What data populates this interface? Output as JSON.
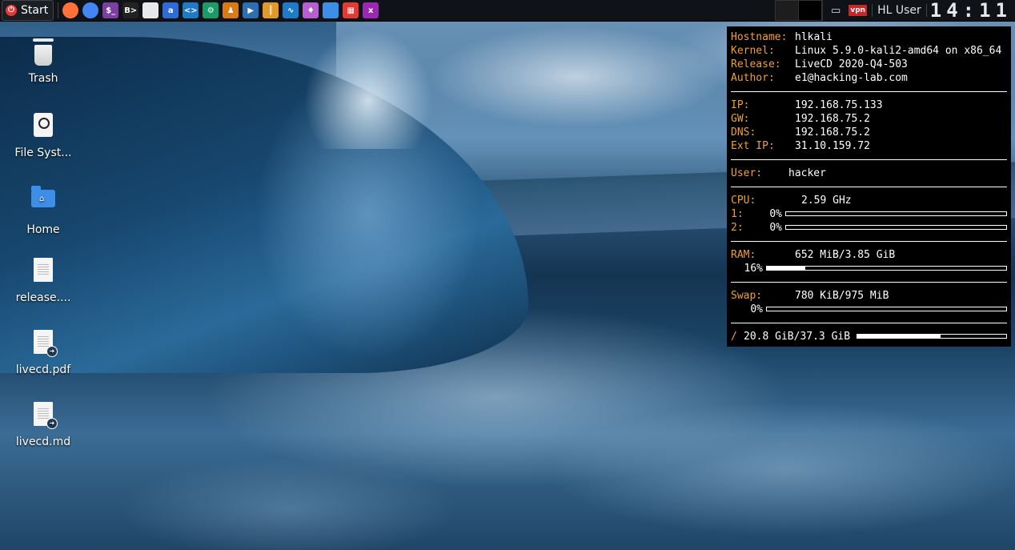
{
  "taskbar": {
    "start_label": "Start",
    "launchers": [
      {
        "name": "firefox-icon",
        "color": "#ff7139",
        "glyph": ""
      },
      {
        "name": "chrome-icon",
        "color": "#4285f4",
        "glyph": ""
      },
      {
        "name": "terminal-purple-icon",
        "color": "#7b3fa0",
        "glyph": "$_"
      },
      {
        "name": "root-terminal-icon",
        "color": "#222",
        "glyph": "B>"
      },
      {
        "name": "files-icon",
        "color": "#e8e8e8",
        "glyph": ""
      },
      {
        "name": "app-a-icon",
        "color": "#2d6bd6",
        "glyph": "a"
      },
      {
        "name": "vscode-icon",
        "color": "#1e79c8",
        "glyph": "<>"
      },
      {
        "name": "gear-app-icon",
        "color": "#1a9b6a",
        "glyph": "⚙"
      },
      {
        "name": "burp-icon",
        "color": "#d97a16",
        "glyph": "♟"
      },
      {
        "name": "shark-icon",
        "color": "#2e6fb4",
        "glyph": "▶"
      },
      {
        "name": "bookmark-icon",
        "color": "#e09a2c",
        "glyph": "║"
      },
      {
        "name": "wireshark-icon",
        "color": "#1d7bc9",
        "glyph": "∿"
      },
      {
        "name": "fire-icon",
        "color": "#b65fd0",
        "glyph": "♦"
      },
      {
        "name": "folder-icon",
        "color": "#3d8ee6",
        "glyph": ""
      },
      {
        "name": "grid-app-icon",
        "color": "#e53935",
        "glyph": "▦"
      },
      {
        "name": "monitor-icon",
        "color": "#9c27b0",
        "glyph": "x"
      }
    ],
    "tray_user": "HL User",
    "vpn_label": "vpn",
    "clock": "14:11"
  },
  "desktop_icons": [
    {
      "label": "Trash"
    },
    {
      "label": "File Syst..."
    },
    {
      "label": "Home"
    },
    {
      "label": "release...."
    },
    {
      "label": "livecd.pdf"
    },
    {
      "label": "livecd.md"
    }
  ],
  "conky": {
    "hostname_key": "Hostname:",
    "hostname": "hlkali",
    "kernel_key": "Kernel:",
    "kernel": "Linux 5.9.0-kali2-amd64 on x86_64",
    "release_key": "Release:",
    "release": "LiveCD 2020-Q4-503",
    "author_key": "Author:",
    "author": "e1@hacking-lab.com",
    "ip_key": "IP:",
    "ip": "192.168.75.133",
    "gw_key": "GW:",
    "gw": "192.168.75.2",
    "dns_key": "DNS:",
    "dns": "192.168.75.2",
    "extip_key": "Ext IP:",
    "extip": "31.10.159.72",
    "user_key": "User:",
    "user": "hacker",
    "cpu_key": "CPU:",
    "cpu": "2.59 GHz",
    "core1_key": "1:",
    "core1_pct": "0%",
    "core1_fill": 0,
    "core2_key": "2:",
    "core2_pct": "0%",
    "core2_fill": 0,
    "ram_key": "RAM:",
    "ram": "652 MiB/3.85 GiB",
    "ram_pct": "16%",
    "ram_fill": 16,
    "swap_key": "Swap:",
    "swap": "780 KiB/975 MiB",
    "swap_pct": "0%",
    "swap_fill": 0,
    "disk_key": "/",
    "disk": "20.8 GiB/37.3 GiB",
    "disk_fill": 56
  },
  "colors": {
    "accent": "#f0a030",
    "panel_bg": "#000000"
  }
}
